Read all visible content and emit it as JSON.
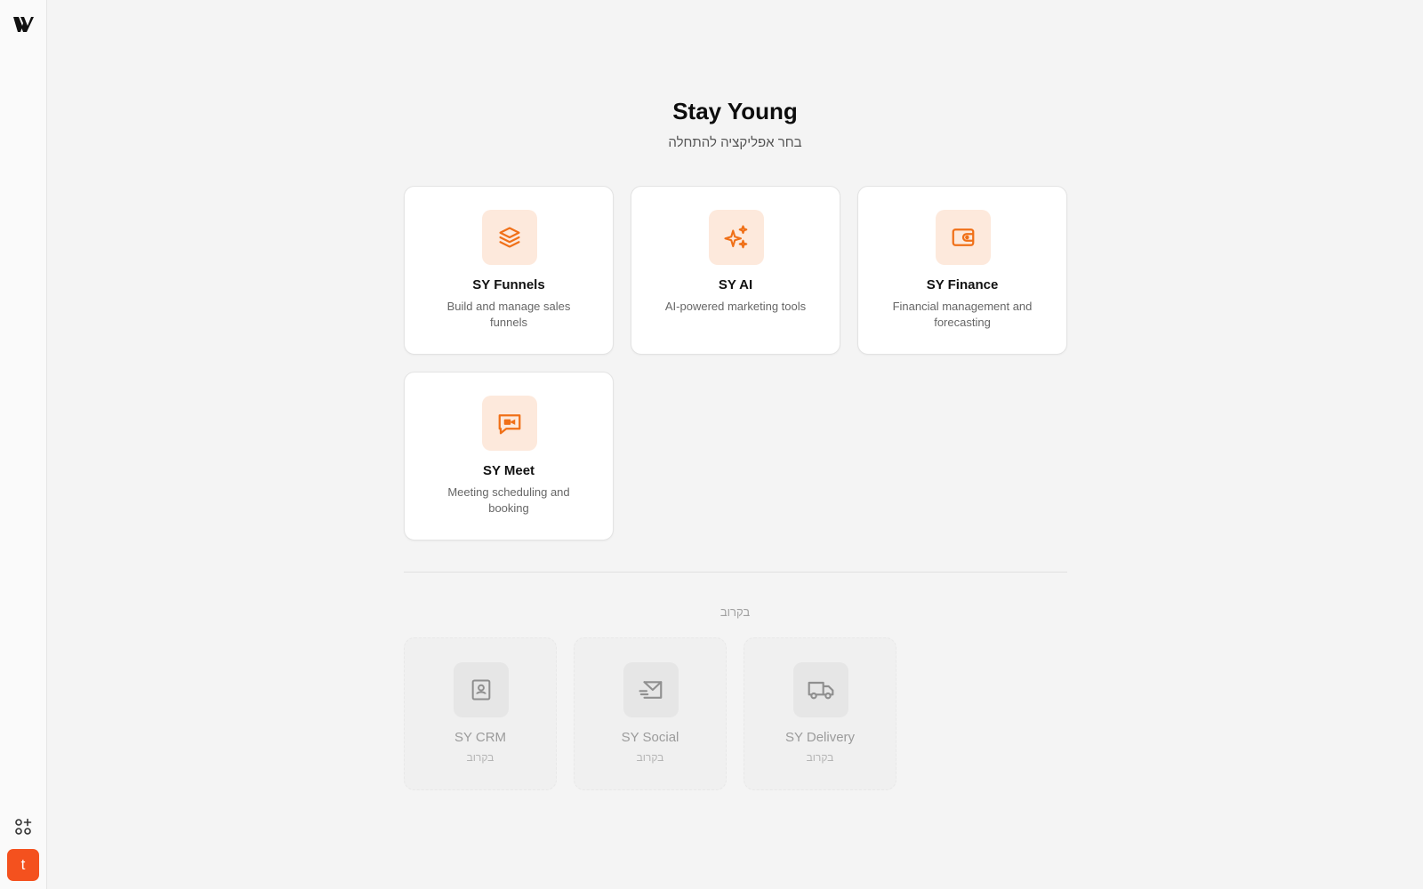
{
  "sidebar": {
    "logo_icon": "brand-logo-icon",
    "apps_icon": "apps-add-icon",
    "avatar_letter": "t",
    "avatar_color": "#f4511e"
  },
  "header": {
    "title": "Stay Young",
    "subtitle": "בחר אפליקציה להתחלה"
  },
  "apps": [
    {
      "name": "SY Funnels",
      "desc": "Build and manage sales funnels",
      "icon": "layers-icon"
    },
    {
      "name": "SY AI",
      "desc": "AI-powered marketing tools",
      "icon": "sparkles-icon"
    },
    {
      "name": "SY Finance",
      "desc": "Financial management and forecasting",
      "icon": "wallet-icon"
    },
    {
      "name": "SY Meet",
      "desc": "Meeting scheduling and booking",
      "icon": "video-chat-icon"
    }
  ],
  "coming_soon": {
    "heading": "בקרוב",
    "items": [
      {
        "name": "SY CRM",
        "tag": "בקרוב",
        "icon": "contact-book-icon"
      },
      {
        "name": "SY Social",
        "tag": "בקרוב",
        "icon": "send-mail-icon"
      },
      {
        "name": "SY Delivery",
        "tag": "בקרוב",
        "icon": "truck-icon"
      }
    ]
  },
  "colors": {
    "accent": "#f07018",
    "accent_bg": "#fde9dc",
    "background": "#f4f4f4"
  }
}
